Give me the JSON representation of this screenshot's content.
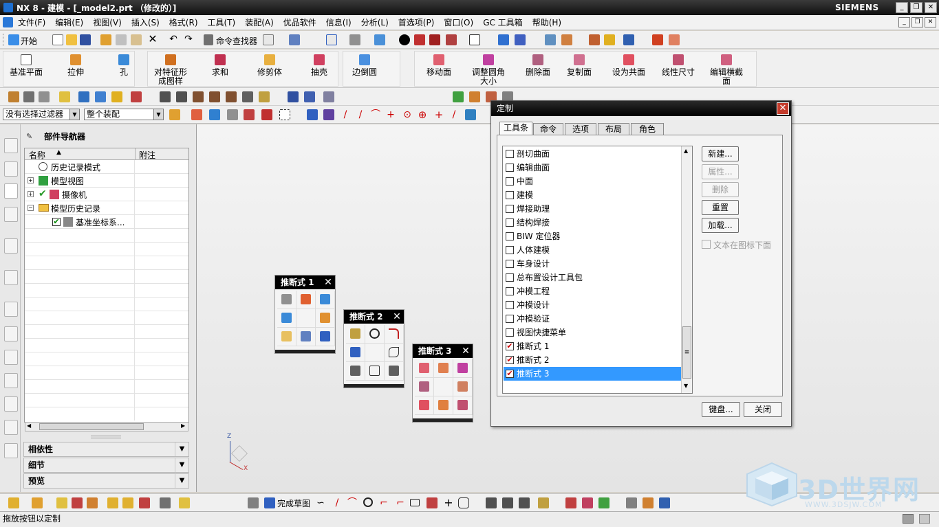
{
  "window": {
    "title": "NX 8 - 建模 - [_model2.prt （修改的）]",
    "brand": "SIEMENS",
    "controls": [
      "_",
      "❐",
      "✕"
    ]
  },
  "menubar": {
    "items": [
      "文件(F)",
      "编辑(E)",
      "视图(V)",
      "插入(S)",
      "格式(R)",
      "工具(T)",
      "装配(A)",
      "优品软件",
      "信息(I)",
      "分析(L)",
      "首选项(P)",
      "窗口(O)",
      "GC 工具箱",
      "帮助(H)"
    ]
  },
  "toolbar1": {
    "start_label": "开始",
    "command_finder_label": "命令查找器"
  },
  "ribbon": {
    "buttons": [
      {
        "label": "基准平面"
      },
      {
        "label": "拉伸"
      },
      {
        "label": "孔"
      },
      {
        "label": "对特征形成图样"
      },
      {
        "label": "求和"
      },
      {
        "label": "修剪体"
      },
      {
        "label": "抽壳"
      },
      {
        "label": "边倒圆"
      },
      {
        "label": "移动面"
      },
      {
        "label": "调整圆角大小"
      },
      {
        "label": "删除面"
      },
      {
        "label": "复制面"
      },
      {
        "label": "设为共面"
      },
      {
        "label": "线性尺寸"
      },
      {
        "label": "编辑横截面"
      }
    ]
  },
  "selection_bar": {
    "filter_value": "没有选择过滤器",
    "scope_value": "整个装配"
  },
  "part_navigator": {
    "title": "部件导航器",
    "columns": [
      "名称",
      "附注"
    ],
    "tree": [
      {
        "label": "历史记录模式"
      },
      {
        "label": "模型视图"
      },
      {
        "label": "摄像机"
      },
      {
        "label": "模型历史记录"
      },
      {
        "label": "基准坐标系..."
      }
    ],
    "panels": [
      "相依性",
      "细节",
      "预览"
    ]
  },
  "palettes": [
    {
      "title": "推断式 1"
    },
    {
      "title": "推断式 2"
    },
    {
      "title": "推断式 3"
    }
  ],
  "customize_dialog": {
    "title": "定制",
    "tabs": [
      "工具条",
      "命令",
      "选项",
      "布局",
      "角色"
    ],
    "list": [
      {
        "label": "剖切曲面",
        "checked": false
      },
      {
        "label": "编辑曲面",
        "checked": false
      },
      {
        "label": "中面",
        "checked": false
      },
      {
        "label": "建模",
        "checked": false
      },
      {
        "label": "焊接助理",
        "checked": false
      },
      {
        "label": "结构焊接",
        "checked": false
      },
      {
        "label": "BIW 定位器",
        "checked": false
      },
      {
        "label": "人体建模",
        "checked": false
      },
      {
        "label": "车身设计",
        "checked": false
      },
      {
        "label": "总布置设计工具包",
        "checked": false
      },
      {
        "label": "冲模工程",
        "checked": false
      },
      {
        "label": "冲模设计",
        "checked": false
      },
      {
        "label": "冲模验证",
        "checked": false
      },
      {
        "label": "视图快捷菜单",
        "checked": false
      },
      {
        "label": "推断式 1",
        "checked": true
      },
      {
        "label": "推断式 2",
        "checked": true
      },
      {
        "label": "推断式 3",
        "checked": true
      }
    ],
    "buttons": {
      "new": "新建...",
      "properties": "属性...",
      "delete": "删除",
      "reset": "重置",
      "load": "加载...",
      "text_below_icon": "文本在图标下面",
      "keyboard": "键盘...",
      "close": "关闭"
    }
  },
  "bottom_toolbar": {
    "finish_sketch_label": "完成草图"
  },
  "status_bar": {
    "message": "拖放按钮以定制"
  },
  "watermark": {
    "text": "3D世界网",
    "url": "WWW.3DSJW.COM"
  },
  "colors": {
    "selection": "#3399ff",
    "titlebar": "#101010",
    "check": "#cc0000"
  }
}
